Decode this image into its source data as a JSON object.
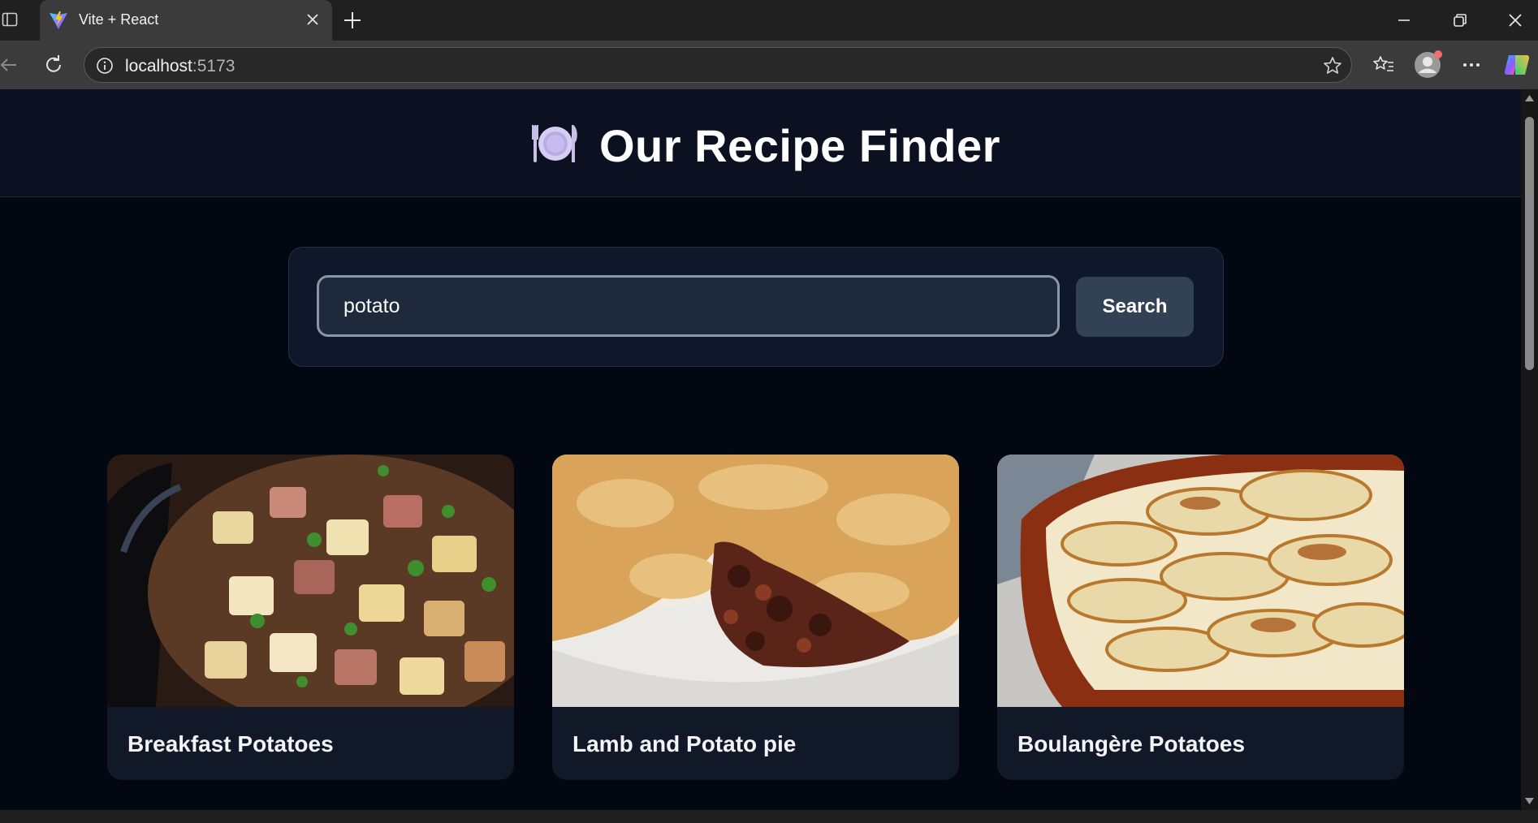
{
  "browser": {
    "tab_title": "Vite + React",
    "url_host": "localhost",
    "url_port": ":5173"
  },
  "app": {
    "title": "Our Recipe Finder",
    "logo_icon": "plate-with-cutlery-icon"
  },
  "search": {
    "query": "potato",
    "button_label": "Search"
  },
  "recipes": [
    {
      "title": "Breakfast Potatoes",
      "image": "breakfast-potatoes-photo"
    },
    {
      "title": "Lamb and Potato pie",
      "image": "lamb-potato-pie-photo"
    },
    {
      "title": "Boulangère Potatoes",
      "image": "boulangere-potatoes-photo"
    }
  ],
  "colors": {
    "page_bg": "#030712",
    "header_bg": "#0b1120",
    "card_bg": "#111827",
    "search_button_bg": "#334155"
  }
}
